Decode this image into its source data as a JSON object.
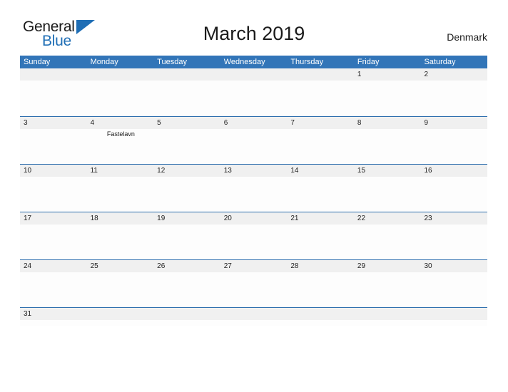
{
  "brand": {
    "name_part1": "General",
    "name_part2": "Blue"
  },
  "header": {
    "title": "March 2019",
    "country": "Denmark"
  },
  "calendar": {
    "weekdays": [
      "Sunday",
      "Monday",
      "Tuesday",
      "Wednesday",
      "Thursday",
      "Friday",
      "Saturday"
    ],
    "colors": {
      "header_blue": "#3275b8",
      "row_border_blue": "#2f6fae",
      "date_band_gray": "#f0f0f0",
      "brand_blue": "#1f6eb5"
    },
    "weeks": [
      [
        {
          "day": "",
          "events": []
        },
        {
          "day": "",
          "events": []
        },
        {
          "day": "",
          "events": []
        },
        {
          "day": "",
          "events": []
        },
        {
          "day": "",
          "events": []
        },
        {
          "day": "1",
          "events": []
        },
        {
          "day": "2",
          "events": []
        }
      ],
      [
        {
          "day": "3",
          "events": []
        },
        {
          "day": "4",
          "events": [
            "Fastelavn"
          ]
        },
        {
          "day": "5",
          "events": []
        },
        {
          "day": "6",
          "events": []
        },
        {
          "day": "7",
          "events": []
        },
        {
          "day": "8",
          "events": []
        },
        {
          "day": "9",
          "events": []
        }
      ],
      [
        {
          "day": "10",
          "events": []
        },
        {
          "day": "11",
          "events": []
        },
        {
          "day": "12",
          "events": []
        },
        {
          "day": "13",
          "events": []
        },
        {
          "day": "14",
          "events": []
        },
        {
          "day": "15",
          "events": []
        },
        {
          "day": "16",
          "events": []
        }
      ],
      [
        {
          "day": "17",
          "events": []
        },
        {
          "day": "18",
          "events": []
        },
        {
          "day": "19",
          "events": []
        },
        {
          "day": "20",
          "events": []
        },
        {
          "day": "21",
          "events": []
        },
        {
          "day": "22",
          "events": []
        },
        {
          "day": "23",
          "events": []
        }
      ],
      [
        {
          "day": "24",
          "events": []
        },
        {
          "day": "25",
          "events": []
        },
        {
          "day": "26",
          "events": []
        },
        {
          "day": "27",
          "events": []
        },
        {
          "day": "28",
          "events": []
        },
        {
          "day": "29",
          "events": []
        },
        {
          "day": "30",
          "events": []
        }
      ],
      [
        {
          "day": "31",
          "events": []
        },
        {
          "day": "",
          "events": []
        },
        {
          "day": "",
          "events": []
        },
        {
          "day": "",
          "events": []
        },
        {
          "day": "",
          "events": []
        },
        {
          "day": "",
          "events": []
        },
        {
          "day": "",
          "events": []
        }
      ]
    ]
  }
}
